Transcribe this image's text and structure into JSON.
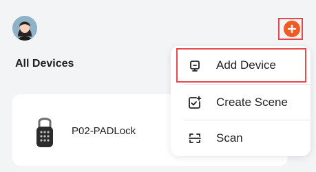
{
  "header": {
    "avatar_icon": "user-avatar",
    "add_icon": "plus-icon",
    "accent_color": "#f15a24"
  },
  "main": {
    "title": "All Devices",
    "devices": [
      {
        "name": "P02-PADLock",
        "icon": "padlock-icon"
      }
    ]
  },
  "menu": {
    "items": [
      {
        "label": "Add Device",
        "icon": "add-device-icon"
      },
      {
        "label": "Create Scene",
        "icon": "create-scene-icon"
      },
      {
        "label": "Scan",
        "icon": "scan-icon"
      }
    ]
  },
  "highlight_color": "#e5484d"
}
